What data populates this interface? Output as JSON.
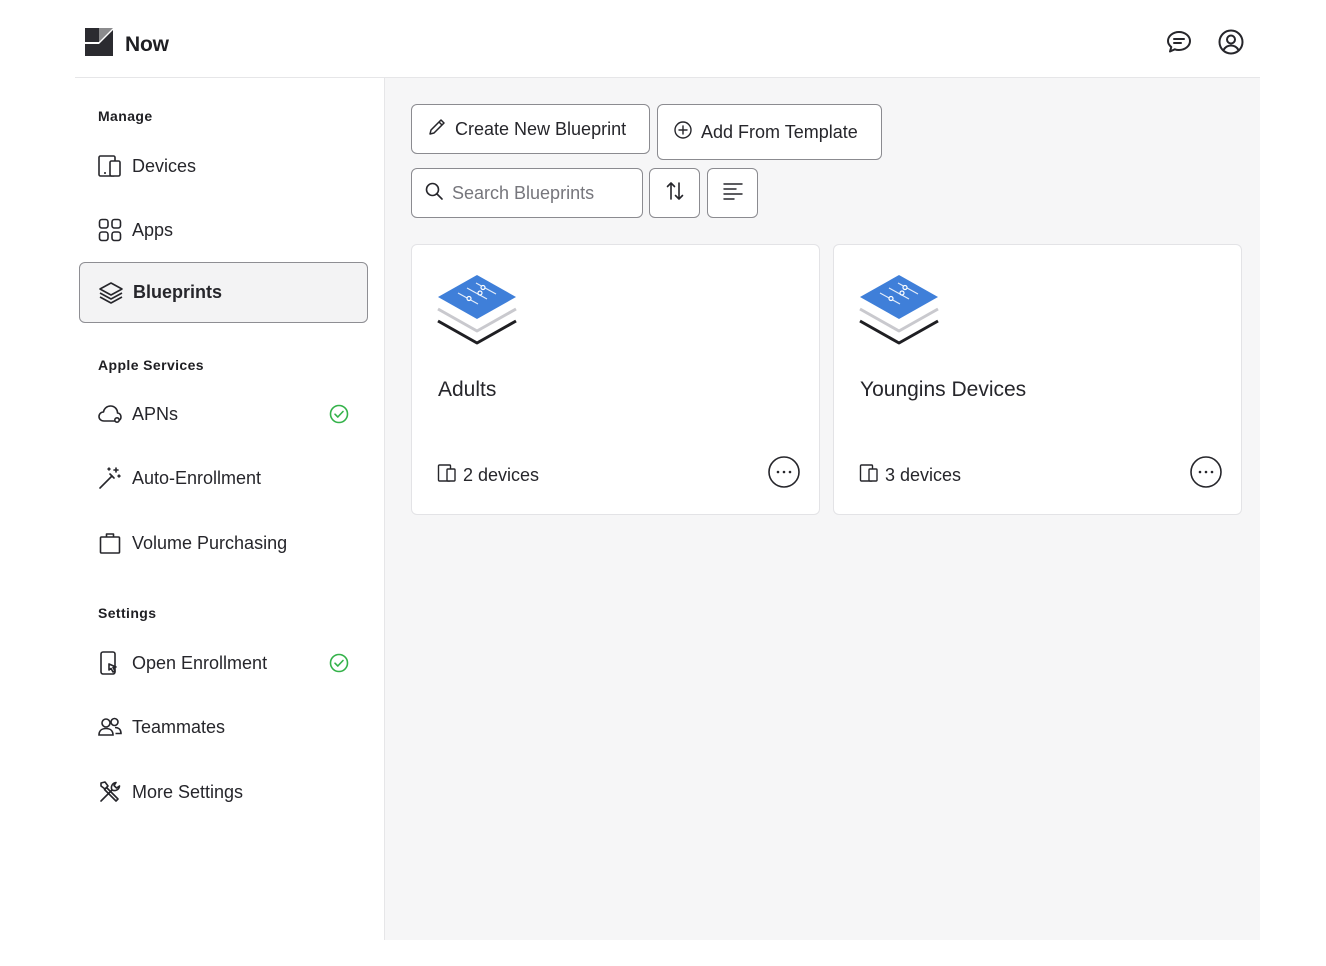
{
  "header": {
    "brand_name": "Now",
    "icons": [
      "chat-icon",
      "account-icon"
    ]
  },
  "sidebar": {
    "sections": [
      {
        "title": "Manage",
        "items": [
          {
            "label": "Devices",
            "icon": "devices-icon"
          },
          {
            "label": "Apps",
            "icon": "apps-grid-icon"
          },
          {
            "label": "Blueprints",
            "icon": "layers-icon",
            "active": true
          }
        ]
      },
      {
        "title": "Apple Services",
        "items": [
          {
            "label": "APNs",
            "icon": "cloud-icon",
            "status": "ok"
          },
          {
            "label": "Auto-Enrollment",
            "icon": "magic-wand-icon"
          },
          {
            "label": "Volume Purchasing",
            "icon": "shopping-bag-icon"
          }
        ]
      },
      {
        "title": "Settings",
        "items": [
          {
            "label": "Open Enrollment",
            "icon": "phone-touch-icon",
            "status": "ok"
          },
          {
            "label": "Teammates",
            "icon": "users-icon"
          },
          {
            "label": "More Settings",
            "icon": "tools-icon"
          }
        ]
      }
    ]
  },
  "toolbar": {
    "create_label": "Create New Blueprint",
    "template_label": "Add From Template",
    "search_placeholder": "Search Blueprints",
    "sort_icon": "sort-icon",
    "filter_icon": "filter-lines-icon"
  },
  "blueprints": [
    {
      "name": "Adults",
      "devices": "2 devices"
    },
    {
      "name": "Youngins Devices",
      "devices": "3 devices"
    }
  ],
  "colors": {
    "accent_blue": "#3f7fd9",
    "success_green": "#34b24a",
    "border": "#8b8b90",
    "main_bg": "#f6f6f7"
  }
}
